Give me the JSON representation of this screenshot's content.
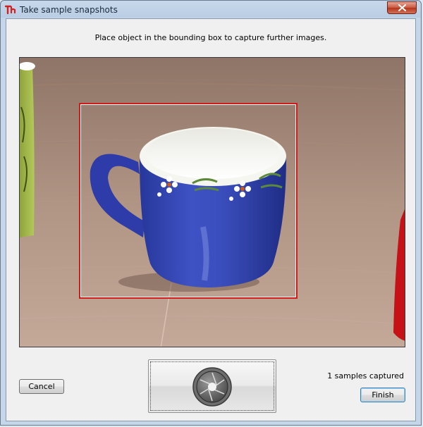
{
  "window": {
    "title": "Take sample snapshots"
  },
  "instruction": "Place object in the bounding box to capture further images.",
  "status": "1 samples captured",
  "buttons": {
    "cancel": "Cancel",
    "finish": "Finish"
  },
  "icons": {
    "app": "app-logo-icon",
    "close": "close-icon",
    "capture": "camera-shutter-icon"
  },
  "colors": {
    "bbox": "#d11a1a",
    "close_button": "#c75a41",
    "titlebar": "#b9cde4"
  }
}
